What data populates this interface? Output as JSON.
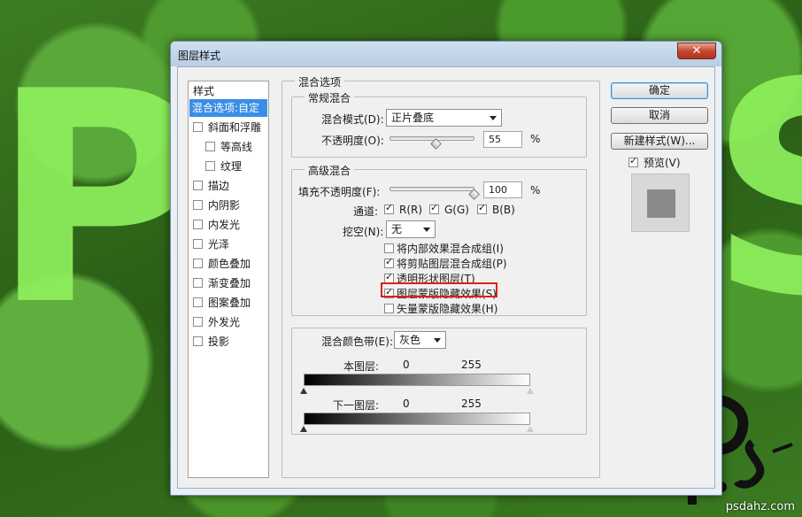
{
  "dialog": {
    "title": "图层样式",
    "close_glyph": "✕"
  },
  "style_list": {
    "header": "样式",
    "items": [
      {
        "label": "混合选项:自定",
        "selected": true,
        "checkbox": false
      },
      {
        "label": "斜面和浮雕",
        "checkbox": true,
        "checked": false
      },
      {
        "label": "等高线",
        "checkbox": true,
        "checked": false,
        "indent": true
      },
      {
        "label": "纹理",
        "checkbox": true,
        "checked": false,
        "indent": true
      },
      {
        "label": "描边",
        "checkbox": true,
        "checked": false
      },
      {
        "label": "内阴影",
        "checkbox": true,
        "checked": false
      },
      {
        "label": "内发光",
        "checkbox": true,
        "checked": false
      },
      {
        "label": "光泽",
        "checkbox": true,
        "checked": false
      },
      {
        "label": "颜色叠加",
        "checkbox": true,
        "checked": false
      },
      {
        "label": "渐变叠加",
        "checkbox": true,
        "checked": false
      },
      {
        "label": "图案叠加",
        "checkbox": true,
        "checked": false
      },
      {
        "label": "外发光",
        "checkbox": true,
        "checked": false
      },
      {
        "label": "投影",
        "checkbox": true,
        "checked": false
      }
    ]
  },
  "blending": {
    "title": "混合选项",
    "general": {
      "title": "常规混合",
      "mode_label": "混合模式(D):",
      "mode_value": "正片叠底",
      "opacity_label": "不透明度(O):",
      "opacity_value": "55",
      "opacity_unit": "%",
      "opacity_fraction": 0.55
    },
    "advanced": {
      "title": "高级混合",
      "fill_label": "填充不透明度(F):",
      "fill_value": "100",
      "fill_unit": "%",
      "fill_fraction": 1.0,
      "channels_label": "通道:",
      "channels": [
        {
          "label": "R(R)",
          "checked": true
        },
        {
          "label": "G(G)",
          "checked": true
        },
        {
          "label": "B(B)",
          "checked": true
        }
      ],
      "knockout_label": "挖空(N):",
      "knockout_value": "无",
      "options": [
        {
          "label": "将内部效果混合成组(I)",
          "checked": false
        },
        {
          "label": "将剪贴图层混合成组(P)",
          "checked": true
        },
        {
          "label": "透明形状图层(T)",
          "checked": true
        },
        {
          "label": "图层蒙版隐藏效果(S)",
          "checked": true,
          "highlighted": true
        },
        {
          "label": "矢量蒙版隐藏效果(H)",
          "checked": false
        }
      ]
    },
    "blend_if": {
      "label": "混合颜色带(E):",
      "value": "灰色",
      "this_layer": {
        "label": "本图层:",
        "min": "0",
        "max": "255"
      },
      "underlying": {
        "label": "下一图层:",
        "min": "0",
        "max": "255"
      }
    }
  },
  "buttons": {
    "ok": "确定",
    "cancel": "取消",
    "new_style": "新建样式(W)...",
    "preview_label": "预览(V)",
    "preview_checked": true
  },
  "background": {
    "letter_left": "P",
    "letter_right": "S",
    "watermark_url": "psdahz.com"
  },
  "colors": {
    "accent": "#3a8ee6",
    "highlight": "#e01e1e",
    "close": "#c44a32"
  }
}
